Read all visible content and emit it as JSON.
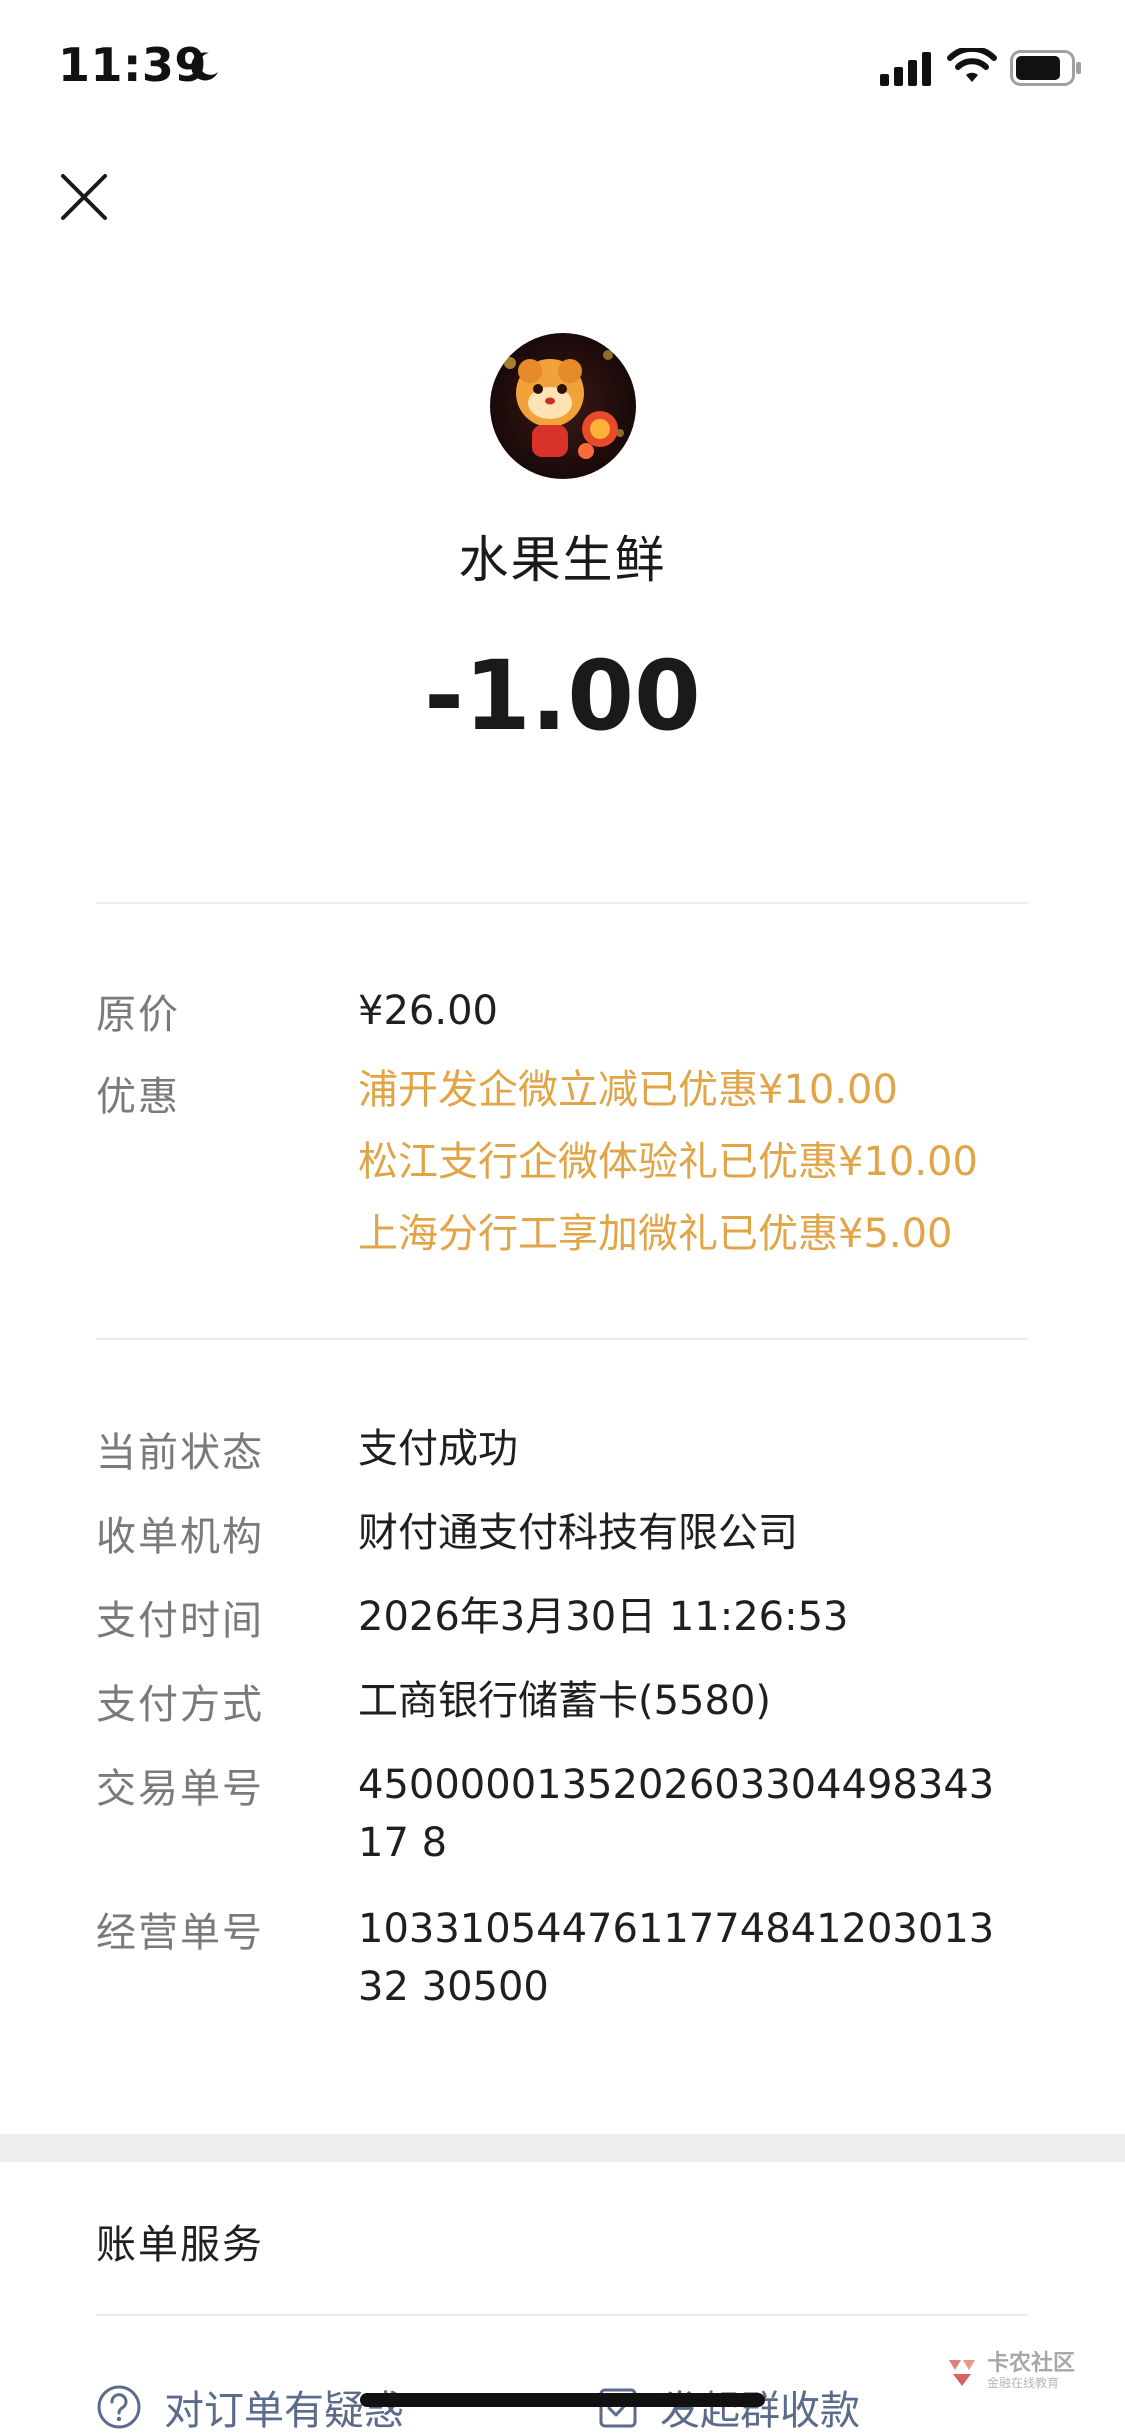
{
  "status_bar": {
    "time": "11:39"
  },
  "header": {
    "merchant_name": "水果生鲜",
    "amount": "-1.00"
  },
  "pricing": {
    "original_price_label": "原价",
    "original_price_value": "¥26.00",
    "discount_label": "优惠",
    "discounts": [
      "浦开发企微立减已优惠¥10.00",
      "松江支行企微体验礼已优惠¥10.00",
      "上海分行工享加微礼已优惠¥5.00"
    ],
    "discount_color": "#e1a548"
  },
  "details": {
    "status_label": "当前状态",
    "status_value": "支付成功",
    "acquirer_label": "收单机构",
    "acquirer_value": "财付通支付科技有限公司",
    "pay_time_label": "支付时间",
    "pay_time_value": "2026年3月30日 11:26:53",
    "pay_method_label": "支付方式",
    "pay_method_value": "工商银行储蓄卡(5580)",
    "transaction_no_label": "交易单号",
    "transaction_no_value": "450000013520260330449834317 8",
    "merchant_no_label": "经营单号",
    "merchant_no_value": "103310544761177484120301332 30500"
  },
  "services": {
    "title": "账单服务",
    "question_order": "对订单有疑惑",
    "group_collect": "发起群收款"
  },
  "watermark": {
    "title": "卡农社区",
    "subtitle": "金融在线教育"
  }
}
